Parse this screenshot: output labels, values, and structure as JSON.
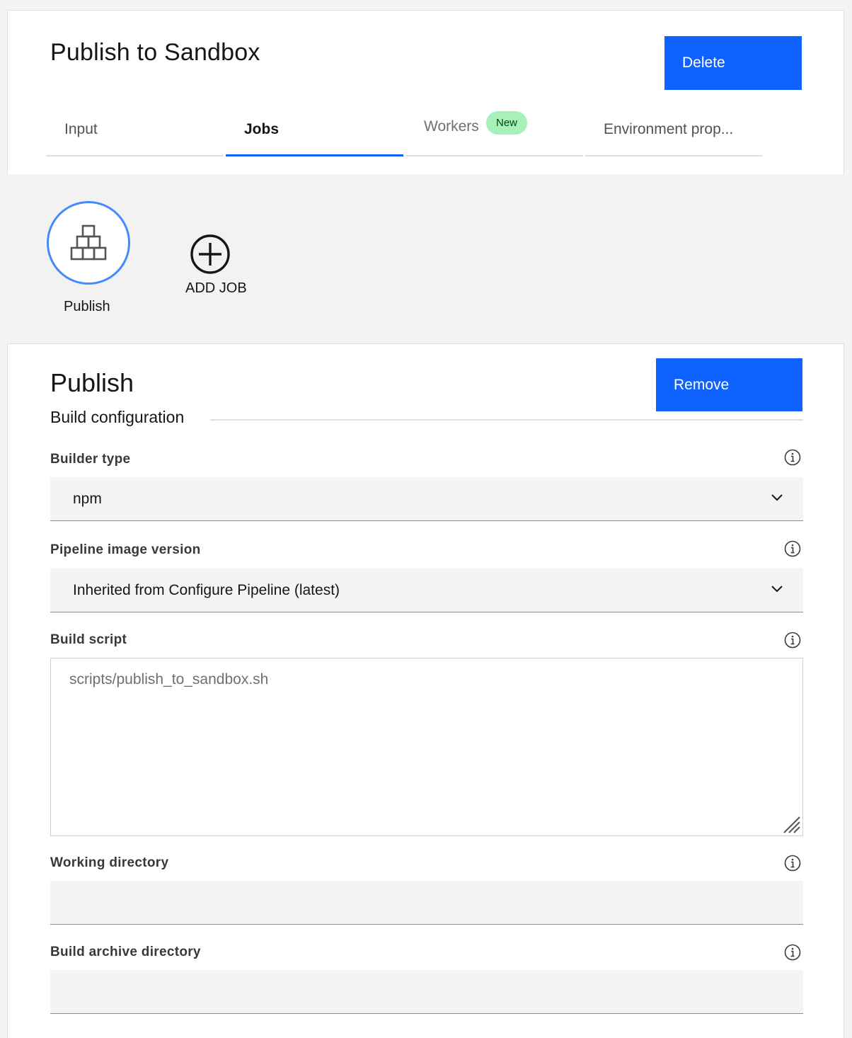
{
  "header": {
    "title": "Publish to Sandbox",
    "delete_label": "Delete"
  },
  "tabs": [
    {
      "label": "Input"
    },
    {
      "label": "Jobs",
      "active": true
    },
    {
      "label": "Workers",
      "badge": "New"
    },
    {
      "label": "Environment prop..."
    }
  ],
  "jobs": {
    "items": [
      {
        "label": "Publish",
        "icon": "stacked-blocks-icon"
      }
    ],
    "add_label": "ADD JOB"
  },
  "job_detail": {
    "title": "Publish",
    "remove_label": "Remove",
    "section_heading": "Build configuration",
    "fields": {
      "builder_type": {
        "label": "Builder type",
        "value": "npm"
      },
      "pipeline_image_version": {
        "label": "Pipeline image version",
        "value": "Inherited from Configure Pipeline (latest)"
      },
      "build_script": {
        "label": "Build script",
        "placeholder": "scripts/publish_to_sandbox.sh"
      },
      "working_directory": {
        "label": "Working directory",
        "value": ""
      },
      "build_archive_directory": {
        "label": "Build archive directory",
        "value": ""
      }
    }
  },
  "colors": {
    "primary": "#0f62fe",
    "active_job_ring": "#4589ff",
    "badge_bg": "#a7f0ba"
  }
}
